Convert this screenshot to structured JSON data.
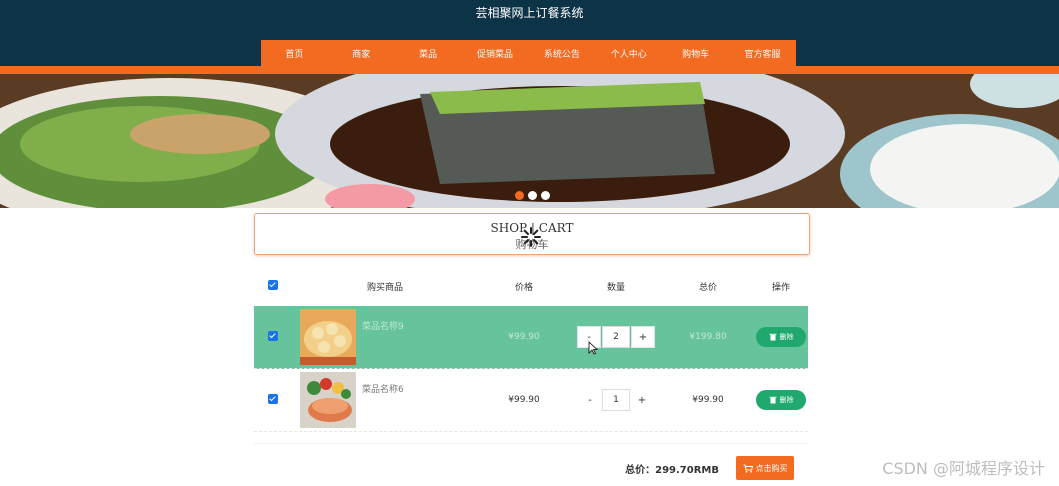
{
  "site": {
    "title": "芸相聚网上订餐系统"
  },
  "nav": {
    "items": [
      {
        "label": "首页"
      },
      {
        "label": "商家"
      },
      {
        "label": "菜品"
      },
      {
        "label": "促销菜品"
      },
      {
        "label": "系统公告"
      },
      {
        "label": "个人中心"
      },
      {
        "label": "购物车"
      },
      {
        "label": "官方客服"
      }
    ]
  },
  "banner": {
    "slide_count": 3,
    "active_slide": 1
  },
  "cart": {
    "title_en": "SHOP | CART",
    "title_cn": "购物车",
    "columns": {
      "product": "购买商品",
      "price": "价格",
      "qty": "数量",
      "total": "总价",
      "op": "操作"
    },
    "rows": [
      {
        "name": "菜品名称9",
        "price": "¥99.90",
        "qty": "2",
        "total": "¥199.80",
        "delete": "删除"
      },
      {
        "name": "菜品名称6",
        "price": "¥99.90",
        "qty": "1",
        "total": "¥99.90",
        "delete": "删除"
      }
    ],
    "minus": "-",
    "plus": "+",
    "summary": {
      "total": "总价：299.70RMB",
      "buy": "点击购买"
    }
  },
  "watermark": "CSDN @阿城程序设计",
  "colors": {
    "header": "#0d3346",
    "accent": "#f36a21",
    "highlight_row": "#67c39b",
    "delete_button": "#20a86e"
  }
}
